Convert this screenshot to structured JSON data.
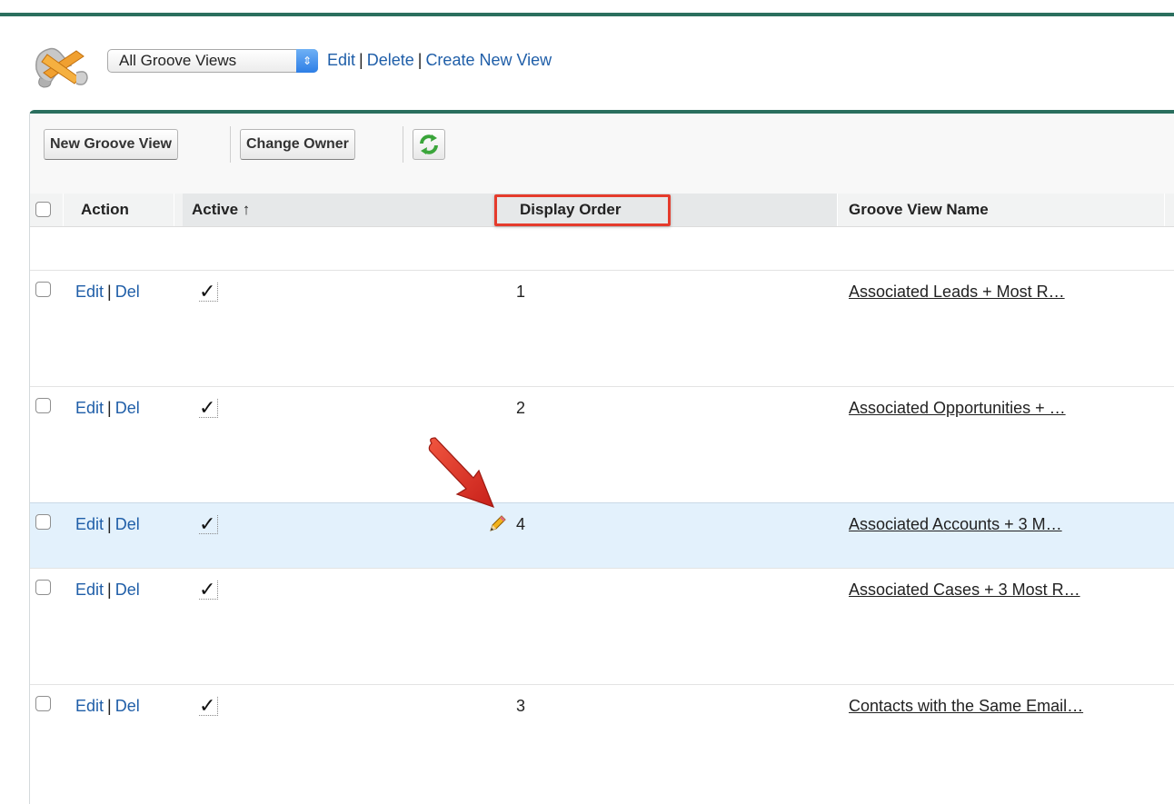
{
  "view_bar": {
    "logo_icon": "groove-logo-icon",
    "selected_view": "All Groove Views",
    "links": [
      "Edit",
      "Delete",
      "Create New View"
    ]
  },
  "toolbar": {
    "new_button": "New Groove View",
    "change_owner_button": "Change Owner",
    "refresh_icon": "refresh-icon"
  },
  "table": {
    "headers": {
      "action": "Action",
      "active": "Active ↑",
      "display_order": "Display Order",
      "name": "Groove View Name"
    },
    "rows": [
      {
        "edit": "Edit",
        "del": "Del",
        "active": "✓",
        "display_order": "1",
        "name": "Associated Leads + Most R…"
      },
      {
        "edit": "Edit",
        "del": "Del",
        "active": "✓",
        "display_order": "2",
        "name": "Associated Opportunities + …"
      },
      {
        "edit": "Edit",
        "del": "Del",
        "active": "✓",
        "display_order": "4",
        "name": "Associated Accounts + 3 M…",
        "selected": true
      },
      {
        "edit": "Edit",
        "del": "Del",
        "active": "✓",
        "display_order": "",
        "name": "Associated Cases + 3 Most R…"
      },
      {
        "edit": "Edit",
        "del": "Del",
        "active": "✓",
        "display_order": "3",
        "name": "Contacts with the Same Email…"
      }
    ]
  },
  "annotations": {
    "highlight_color": "#e53b2c",
    "arrow_icon": "red-arrow-icon",
    "edit_icon": "pencil-icon"
  }
}
